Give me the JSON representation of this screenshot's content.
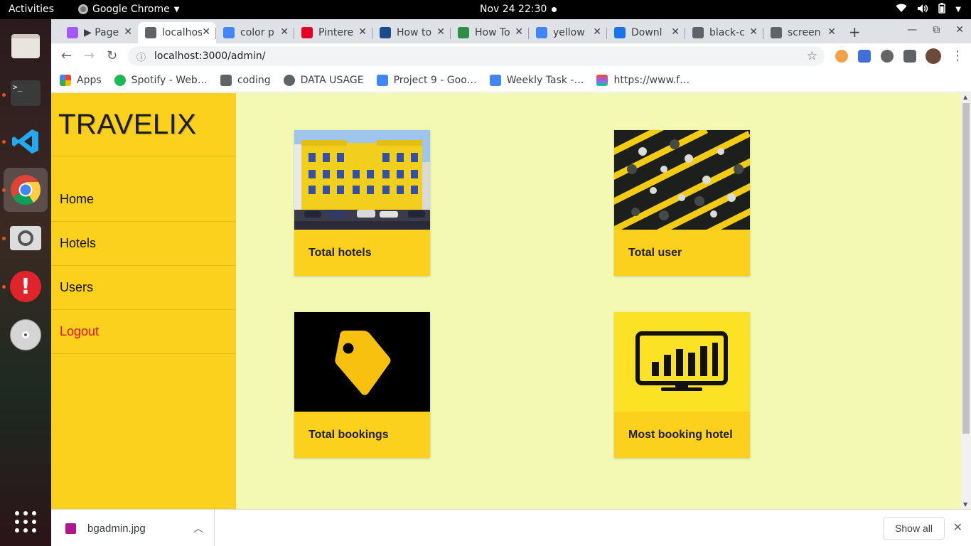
{
  "os": {
    "activities": "Activities",
    "app_name": "Google Chrome",
    "clock": "Nov 24  22:30"
  },
  "dock": {
    "items": [
      "files-icon",
      "terminal-icon",
      "vscode-icon",
      "chrome-icon",
      "image-viewer-icon",
      "software-updater-icon",
      "disc-icon",
      "app-grid-icon"
    ]
  },
  "browser": {
    "tabs": [
      {
        "label": "▶ Page",
        "icon": "figma-icon",
        "color": "#a259ff"
      },
      {
        "label": "localhost",
        "icon": "globe-icon",
        "color": "#5f6368"
      },
      {
        "label": "color p",
        "icon": "google-icon",
        "color": "#4285f4"
      },
      {
        "label": "Pintere",
        "icon": "pinterest-icon",
        "color": "#e60023"
      },
      {
        "label": "How to",
        "icon": "e-icon",
        "color": "#1a4b8c"
      },
      {
        "label": "How To",
        "icon": "gfg-icon",
        "color": "#2f8d46"
      },
      {
        "label": "yellow",
        "icon": "google-icon",
        "color": "#4285f4"
      },
      {
        "label": "Downl",
        "icon": "download-icon",
        "color": "#1a73e8"
      },
      {
        "label": "black-c",
        "icon": "globe-icon",
        "color": "#5f6368"
      },
      {
        "label": "screen",
        "icon": "globe-icon",
        "color": "#5f6368"
      }
    ],
    "url": "localhost:3000/admin/",
    "bookmarks": [
      {
        "label": "Apps",
        "icon": "apps-grid-icon"
      },
      {
        "label": "Spotify - Web…",
        "icon": "spotify-icon"
      },
      {
        "label": "coding",
        "icon": "folder-icon"
      },
      {
        "label": "DATA USAGE",
        "icon": "globe-icon"
      },
      {
        "label": "Project 9 - Goo…",
        "icon": "docs-icon"
      },
      {
        "label": "Weekly Task -…",
        "icon": "docs-icon"
      },
      {
        "label": "https://www.f…",
        "icon": "figma-icon"
      }
    ]
  },
  "page": {
    "brand": "TRAVELIX",
    "nav": [
      {
        "label": "Home"
      },
      {
        "label": "Hotels"
      },
      {
        "label": "Users"
      },
      {
        "label": "Logout"
      }
    ],
    "cards": [
      {
        "title": "Total hotels",
        "image": "hotel-building-photo"
      },
      {
        "title": "Total user",
        "image": "crowd-umbrellas-photo"
      },
      {
        "title": "Total bookings",
        "image": "price-tag-icon"
      },
      {
        "title": "Most booking hotel",
        "image": "monitor-bar-chart-icon"
      }
    ],
    "colors": {
      "sidebar": "#fbd11e",
      "background": "#f3f8b3",
      "logout": "#e0101b"
    }
  },
  "downloads": {
    "file": "bgadmin.jpg",
    "show_all": "Show all"
  }
}
